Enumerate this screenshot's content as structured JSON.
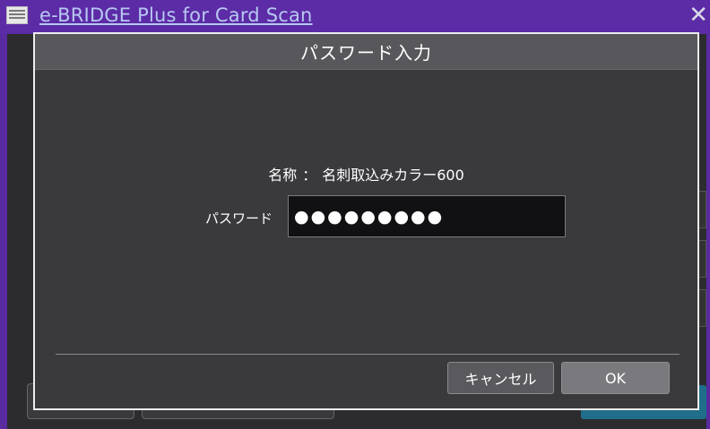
{
  "window": {
    "title": "e-BRIDGE Plus for Card Scan",
    "close_glyph": "✕"
  },
  "dialog": {
    "title": "パスワード入力",
    "name_label": "名称",
    "name_separator": "：",
    "name_value": "名刺取込みカラー600",
    "password_label": "パスワード",
    "password_value": "●●●●●●●●●",
    "cancel_label": "キャンセル",
    "ok_label": "OK"
  },
  "colors": {
    "titlebar": "#5c2ca6",
    "dialog_bg": "#3a3a3d",
    "background_accent_button": "#1f6f8b"
  }
}
